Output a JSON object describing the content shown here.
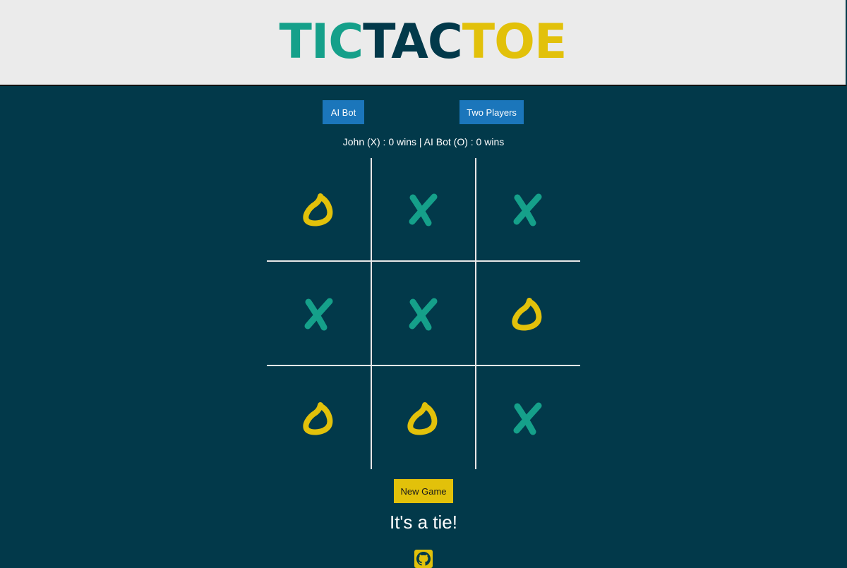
{
  "header": {
    "title_parts": [
      "TIC",
      "TAC",
      "TOE"
    ],
    "title_colors": [
      "#15a08a",
      "#02394a",
      "#e2c10a"
    ]
  },
  "modes": {
    "ai_bot_label": "AI Bot",
    "two_players_label": "Two Players"
  },
  "score": {
    "text": "John (X) : 0 wins | AI Bot (O) : 0 wins"
  },
  "board": {
    "cells": [
      "O",
      "X",
      "X",
      "X",
      "X",
      "O",
      "O",
      "O",
      "X"
    ],
    "x_color": "#15a08a",
    "o_color": "#e2c10a"
  },
  "controls": {
    "new_game_label": "New Game"
  },
  "status": {
    "message": "It's a tie!"
  },
  "footer": {
    "icon": "github-icon"
  }
}
